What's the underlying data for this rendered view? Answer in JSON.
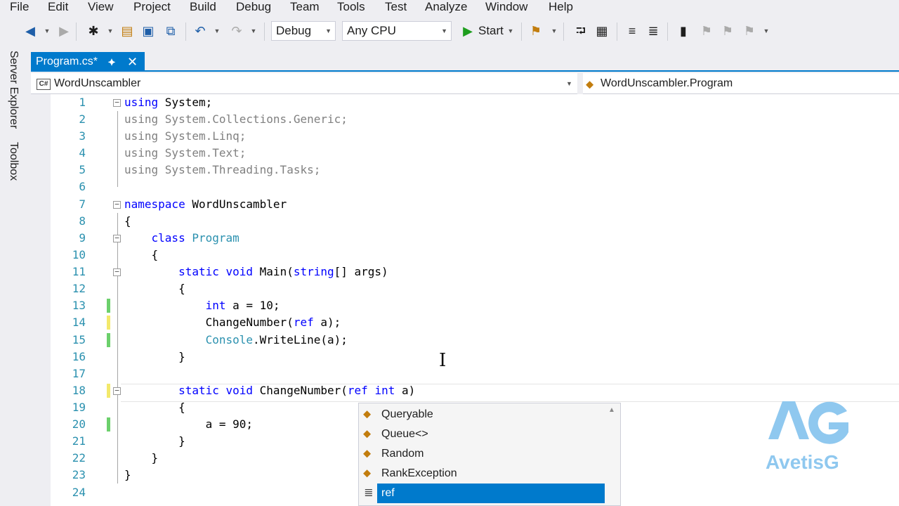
{
  "menu": [
    "File",
    "Edit",
    "View",
    "Project",
    "Build",
    "Debug",
    "Team",
    "Tools",
    "Test",
    "Analyze",
    "Window",
    "Help"
  ],
  "toolbar": {
    "config": "Debug",
    "platform": "Any CPU",
    "start_label": "Start"
  },
  "sidebar": {
    "server_explorer": "Server Explorer",
    "toolbox": "Toolbox"
  },
  "tab": {
    "title": "Program.cs*",
    "pin": "⯌",
    "close": "✕"
  },
  "navbar": {
    "project_icon": "C#",
    "project": "WordUnscambler",
    "type": "WordUnscambler.Program"
  },
  "code_lines": [
    {
      "n": "1"
    },
    {
      "n": "2"
    },
    {
      "n": "3"
    },
    {
      "n": "4"
    },
    {
      "n": "5"
    },
    {
      "n": "6"
    },
    {
      "n": "7"
    },
    {
      "n": "8"
    },
    {
      "n": "9"
    },
    {
      "n": "10"
    },
    {
      "n": "11"
    },
    {
      "n": "12"
    },
    {
      "n": "13"
    },
    {
      "n": "14"
    },
    {
      "n": "15"
    },
    {
      "n": "16"
    },
    {
      "n": "17"
    },
    {
      "n": "18"
    },
    {
      "n": "19"
    },
    {
      "n": "20"
    },
    {
      "n": "21"
    },
    {
      "n": "22"
    },
    {
      "n": "23"
    },
    {
      "n": "24"
    }
  ],
  "code": {
    "l1": [
      "using",
      " System;"
    ],
    "l2": "using System.Collections.Generic;",
    "l3": "using System.Linq;",
    "l4": "using System.Text;",
    "l5": "using System.Threading.Tasks;",
    "l7": [
      "namespace",
      " WordUnscambler"
    ],
    "l8": "{",
    "l9": [
      "class",
      "Program"
    ],
    "l10": "{",
    "l11": [
      "static",
      "void",
      " Main(",
      "string",
      "[] args)"
    ],
    "l12": "{",
    "l13": [
      "int",
      " a = 10;"
    ],
    "l14": [
      "ChangeNumber(",
      "ref",
      " a);"
    ],
    "l15": [
      "Console",
      ".WriteLine(a);"
    ],
    "l16": "}",
    "l18": [
      "static",
      "void",
      " ChangeNumber(",
      "ref",
      "int",
      " a)"
    ],
    "l19": "{",
    "l20": "a = 90;",
    "l21": "}",
    "l22": "}",
    "l23": "}"
  },
  "intellisense": {
    "items": [
      "Queryable",
      "Queue<>",
      "Random",
      "RankException",
      "ref"
    ]
  },
  "watermark": {
    "text": "AvetisG"
  }
}
